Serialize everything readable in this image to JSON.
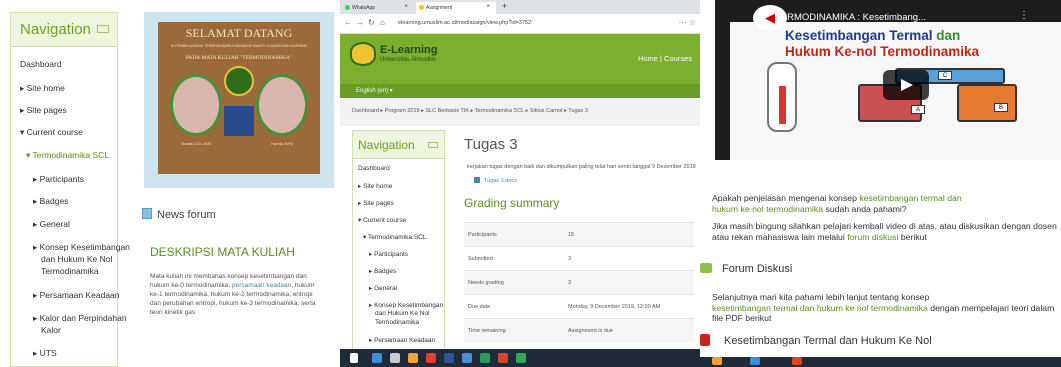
{
  "left": {
    "nav": {
      "title": "Navigation",
      "items": [
        "Dashboard",
        "Site home",
        "Site pages",
        "Current course",
        "Termodinamika SCL",
        "Participants",
        "Badges",
        "General",
        "Konsep Kesetimbangan",
        "dan Hukum Ke Nol",
        "Termodinamika",
        "Persamaan Keadaan",
        "Kalor dan Perpindahan",
        "Kalor",
        "UTS"
      ]
    },
    "banner": {
      "title": "SELAMAT DATANG",
      "subtitle": "DI PEMBELAJARAN TERMODINAMIKA BERBASIS SMART CLASSROOM LEARNING",
      "course": "PADA MATA KULIAH \"TERMODINAMIKA\"",
      "person1": "Nurasti, LTD., M.Si",
      "person2": "Harmia, M.Pd"
    },
    "news_forum": "News forum",
    "section_title": "DESKRIPSI MATA KULIAH",
    "desc_a": "Mata kuliah ini membahas konsep kesetimbangan dan hukum ke-0 termodinamika, ",
    "desc_link": "persamaan keadaan",
    "desc_b": ", hukum ke-1 termodinamika, hukum ke-2 termodinamika, entropi dan perubahan entropi, hukum ke-3 termodinamika, serta teori kinetik gas"
  },
  "middle": {
    "tabs": [
      "WhatsApp",
      "Assignment"
    ],
    "url": "elearning.umuslim.ac.id/mod/assign/view.php?id=3752",
    "site_title": "E-Learning",
    "site_sub": "Universitas Almuslim",
    "home_link": "Home | Courses",
    "language": "English (en) ▾",
    "breadcrumb": "Dashboard ▸ Program 2019 ▸ SLC Berbasis TIK ▸ Termodinamika SCL ▸ Siklus Carnot ▸ Tugas 3",
    "nav": {
      "title": "Navigation",
      "items": [
        "Dashboard",
        "Site home",
        "Site pages",
        "Current course",
        "Termodinamika SCL",
        "Participants",
        "Badges",
        "General",
        "Konsep Kesetimbangan",
        "dan Hukum Ke Nol",
        "Termodinamika",
        "Persamaan Keadaan"
      ]
    },
    "page_title": "Tugas 3",
    "instruction": "kerjakan tugas dengan baik dan dikumpulkan paling telat hari senin tanggal 9 Desember 2019",
    "file": "Tugas 3.docx",
    "grading_title": "Grading summary",
    "grading": [
      {
        "k": "Participants",
        "v": "15"
      },
      {
        "k": "Submitted",
        "v": "3"
      },
      {
        "k": "Needs grading",
        "v": "3"
      },
      {
        "k": "Due date",
        "v": "Monday, 9 December 2019, 12:00 AM"
      },
      {
        "k": "Time remaining",
        "v": "Assignment is due"
      }
    ]
  },
  "right": {
    "video_title": "TERMODINAMIKA : Kesetimbang...",
    "heading1a": "Kesetimbangan Termal ",
    "heading1b": "dan",
    "heading2": "Hukum Ke-nol Termodinamika",
    "box_labels": [
      "A",
      "B",
      "C"
    ],
    "p1_a": "Apakah penjelasan mengenai konsep ",
    "p1_b": "kesetimbangan termal dan",
    "p1_c": "hukum ke nol termodinamika",
    "p1_d": " sudah anda pahami?",
    "p2_a": "Jika masih bingung silahkan pelajari kembali video di atas, atau diskusikan dengan dosen atau rekan mahasiswa lain melalui ",
    "p2_b": "forum diskusi",
    "p2_c": " berikut",
    "forum": "Forum Diskusi",
    "p3_a": "Selanjutnya mari kita pahami lebih lanjut tentang konsep",
    "p3_b": "kesetimbangan termal dan hukum ke nol termodinamika",
    "p3_c": " dengan mempelajari teori dalam file PDF berikut",
    "pdf": "Kesetimbangan Termal dan Hukum Ke Nol"
  }
}
